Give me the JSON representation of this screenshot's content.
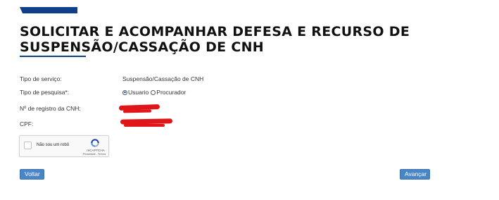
{
  "page": {
    "title": "SOLICITAR E ACOMPANHAR DEFESA E RECURSO DE SUSPENSÃO/CASSAÇÃO DE CNH"
  },
  "form": {
    "tipo_servico": {
      "label": "Tipo de serviço:",
      "value": "Suspensão/Cassação de CNH"
    },
    "tipo_pesquisa": {
      "label": "Tipo de pesquisa*:",
      "options": [
        {
          "label": "Usuario",
          "selected": true
        },
        {
          "label": "Procurador",
          "selected": false
        }
      ]
    },
    "registro_cnh": {
      "label": "Nº de registro da CNH:"
    },
    "cpf": {
      "label": "CPF:"
    }
  },
  "captcha": {
    "label": "Não sou um robô",
    "brand": "reCAPTCHA",
    "links": "Privacidade - Termos"
  },
  "buttons": {
    "back": "Voltar",
    "next": "Avançar"
  },
  "colors": {
    "accent": "#0d3f8a",
    "button": "#4a86c5",
    "redaction": "#e0151a"
  }
}
